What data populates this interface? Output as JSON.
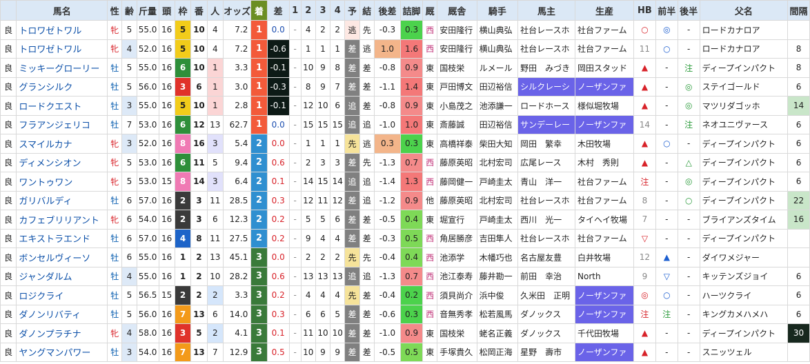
{
  "headers": [
    "馬名",
    "性",
    "齢",
    "斤量",
    "頭",
    "枠",
    "番",
    "人",
    "オッズ",
    "着",
    "差",
    "1",
    "2",
    "3",
    "4",
    "予",
    "結",
    "後差",
    "詰脚",
    "厩",
    "厩舎",
    "騎手",
    "馬主",
    "生産",
    "HB",
    "前半",
    "後半",
    "父名",
    "間隔"
  ],
  "colors": {
    "header_bg": "#dbe8f6",
    "finish_1": "#f35a3a",
    "finish_2": "#2f8fd0",
    "finish_3": "#3a7a3a",
    "gate_1": "#ffffff",
    "gate_2": "#3a3a3a",
    "gate_3": "#e0322a",
    "gate_4": "#1e64c8",
    "gate_5": "#f2cc1a",
    "gate_6": "#2e8f3a",
    "gate_7": "#f39a1a",
    "gate_8": "#f07ab4",
    "owner_highlight": "#6a63e8",
    "interval_bg": "#c9e6c9",
    "interval_dark": "#17281e"
  },
  "rows": [
    {
      "track": "良",
      "name": "トロワゼトワル",
      "sex": "牝",
      "age": "5",
      "weight": "55.0",
      "heads": "16",
      "gate": 5,
      "num": "10",
      "pop": "4",
      "odds": "7.2",
      "finish": "1",
      "margin": "0.0",
      "c1": "-",
      "c2": "4",
      "c3": "2",
      "c4": "2",
      "pred": "逃",
      "result": "先",
      "ato": "-0.3",
      "agari": "0.3",
      "east": "西",
      "trainer": "安田隆行",
      "jockey": "横山典弘",
      "owner": "社台レースホ",
      "breeder": "社台ファーム",
      "hb": "○",
      "zen": "◎",
      "kou": "-",
      "sire": "ロードカナロア",
      "interval": ""
    },
    {
      "track": "良",
      "name": "トロワゼトワル",
      "sex": "牝",
      "age": "4",
      "weight": "52.0",
      "heads": "16",
      "gate": 5,
      "num": "10",
      "pop": "4",
      "odds": "7.2",
      "finish": "1",
      "margin": "-0.6",
      "c1": "-",
      "c2": "1",
      "c3": "1",
      "c4": "1",
      "pred": "差",
      "result": "逃",
      "ato": "1.0",
      "agari": "1.6",
      "east": "西",
      "trainer": "安田隆行",
      "jockey": "横山典弘",
      "owner": "社台レースホ",
      "breeder": "社台ファーム",
      "hb": "11",
      "zen": "○",
      "kou": "-",
      "sire": "ロードカナロア",
      "interval": "8"
    },
    {
      "track": "良",
      "name": "ミッキーグローリー",
      "sex": "牡",
      "age": "5",
      "weight": "55.0",
      "heads": "16",
      "gate": 6,
      "num": "10",
      "pop": "1",
      "odds": "3.3",
      "finish": "1",
      "margin": "-0.1",
      "c1": "-",
      "c2": "10",
      "c3": "9",
      "c4": "8",
      "pred": "差",
      "result": "差",
      "ato": "-0.8",
      "agari": "0.9",
      "east": "東",
      "trainer": "国枝栄",
      "jockey": "ルメール",
      "owner": "野田　みづき",
      "breeder": "岡田スタッド",
      "hb": "▲",
      "zen": "-",
      "kou": "注",
      "sire": "ディープインパクト",
      "interval": "8"
    },
    {
      "track": "良",
      "name": "グランシルク",
      "sex": "牡",
      "age": "5",
      "weight": "56.0",
      "heads": "16",
      "gate": 3,
      "num": "6",
      "pop": "1",
      "odds": "3.0",
      "finish": "1",
      "margin": "-0.3",
      "c1": "-",
      "c2": "8",
      "c3": "9",
      "c4": "7",
      "pred": "差",
      "result": "差",
      "ato": "-1.1",
      "agari": "1.4",
      "east": "東",
      "trainer": "戸田博文",
      "jockey": "田辺裕信",
      "owner": "シルクレーシ",
      "breeder": "ノーザンファ",
      "hb": "▲",
      "zen": "-",
      "kou": "◎",
      "sire": "ステイゴールド",
      "interval": "6"
    },
    {
      "track": "良",
      "name": "ロードクエスト",
      "sex": "牡",
      "age": "3",
      "weight": "55.0",
      "heads": "16",
      "gate": 5,
      "num": "10",
      "pop": "1",
      "odds": "2.8",
      "finish": "1",
      "margin": "-0.1",
      "c1": "-",
      "c2": "12",
      "c3": "10",
      "c4": "6",
      "pred": "追",
      "result": "差",
      "ato": "-0.8",
      "agari": "0.9",
      "east": "東",
      "trainer": "小島茂之",
      "jockey": "池添謙一",
      "owner": "ロードホース",
      "breeder": "様似堀牧場",
      "hb": "▲",
      "zen": "-",
      "kou": "◎",
      "sire": "マツリダゴッホ",
      "interval": "14"
    },
    {
      "track": "良",
      "name": "フラアンジェリコ",
      "sex": "牡",
      "age": "7",
      "weight": "53.0",
      "heads": "16",
      "gate": 6,
      "num": "12",
      "pop": "13",
      "odds": "62.7",
      "finish": "1",
      "margin": "0.0",
      "c1": "-",
      "c2": "15",
      "c3": "15",
      "c4": "15",
      "pred": "追",
      "result": "追",
      "ato": "-1.0",
      "agari": "1.0",
      "east": "東",
      "trainer": "斎藤誠",
      "jockey": "田辺裕信",
      "owner": "サンデーレー",
      "breeder": "ノーザンファ",
      "hb": "14",
      "zen": "-",
      "kou": "注",
      "sire": "ネオユニヴァース",
      "interval": "6"
    },
    {
      "track": "良",
      "name": "スマイルカナ",
      "sex": "牝",
      "age": "3",
      "weight": "52.0",
      "heads": "16",
      "gate": 8,
      "num": "16",
      "pop": "3",
      "odds": "5.4",
      "finish": "2",
      "margin": "0.0",
      "c1": "-",
      "c2": "1",
      "c3": "1",
      "c4": "1",
      "pred": "先",
      "result": "逃",
      "ato": "0.3",
      "agari": "0.3",
      "east": "東",
      "trainer": "高橋祥泰",
      "jockey": "柴田大知",
      "owner": "岡田　繁幸",
      "breeder": "木田牧場",
      "hb": "▲",
      "zen": "○",
      "kou": "-",
      "sire": "ディープインパクト",
      "interval": "6"
    },
    {
      "track": "良",
      "name": "ディメンシオン",
      "sex": "牝",
      "age": "5",
      "weight": "53.0",
      "heads": "16",
      "gate": 6,
      "num": "11",
      "pop": "5",
      "odds": "9.4",
      "finish": "2",
      "margin": "0.6",
      "c1": "-",
      "c2": "2",
      "c3": "3",
      "c4": "3",
      "pred": "差",
      "result": "先",
      "ato": "-1.3",
      "agari": "0.7",
      "east": "西",
      "trainer": "藤原英昭",
      "jockey": "北村宏司",
      "owner": "広尾レース",
      "breeder": "木村　秀則",
      "hb": "▲",
      "zen": "-",
      "kou": "△",
      "sire": "ディープインパクト",
      "interval": "6"
    },
    {
      "track": "良",
      "name": "ワントゥワン",
      "sex": "牝",
      "age": "5",
      "weight": "53.0",
      "heads": "15",
      "gate": 8,
      "num": "14",
      "pop": "3",
      "odds": "6.4",
      "finish": "2",
      "margin": "0.1",
      "c1": "-",
      "c2": "14",
      "c3": "15",
      "c4": "14",
      "pred": "追",
      "result": "追",
      "ato": "-1.4",
      "agari": "1.3",
      "east": "西",
      "trainer": "藤岡健一",
      "jockey": "戸崎圭太",
      "owner": "青山　洋一",
      "breeder": "社台ファーム",
      "hb": "注",
      "zen": "-",
      "kou": "◎",
      "sire": "ディープインパクト",
      "interval": "6"
    },
    {
      "track": "良",
      "name": "ガリバルディ",
      "sex": "牡",
      "age": "6",
      "weight": "57.0",
      "heads": "16",
      "gate": 2,
      "num": "3",
      "pop": "11",
      "odds": "28.5",
      "finish": "2",
      "margin": "0.3",
      "c1": "-",
      "c2": "12",
      "c3": "11",
      "c4": "12",
      "pred": "差",
      "result": "追",
      "ato": "-1.2",
      "agari": "0.9",
      "east": "他",
      "trainer": "藤原英昭",
      "jockey": "北村宏司",
      "owner": "社台レースホ",
      "breeder": "社台ファーム",
      "hb": "8",
      "zen": "-",
      "kou": "○",
      "sire": "ディープインパクト",
      "interval": "22"
    },
    {
      "track": "良",
      "name": "カフェブリリアント",
      "sex": "牝",
      "age": "6",
      "weight": "54.0",
      "heads": "16",
      "gate": 2,
      "num": "3",
      "pop": "6",
      "odds": "12.3",
      "finish": "2",
      "margin": "0.2",
      "c1": "-",
      "c2": "5",
      "c3": "5",
      "c4": "6",
      "pred": "差",
      "result": "差",
      "ato": "-0.5",
      "agari": "0.4",
      "east": "東",
      "trainer": "堀宣行",
      "jockey": "戸崎圭太",
      "owner": "西川　光一",
      "breeder": "タイヘイ牧場",
      "hb": "7",
      "zen": "-",
      "kou": "-",
      "sire": "ブライアンズタイム",
      "interval": "16"
    },
    {
      "track": "良",
      "name": "エキストラエンド",
      "sex": "牡",
      "age": "6",
      "weight": "57.0",
      "heads": "16",
      "gate": 4,
      "num": "8",
      "pop": "11",
      "odds": "27.5",
      "finish": "2",
      "margin": "0.2",
      "c1": "-",
      "c2": "9",
      "c3": "4",
      "c4": "4",
      "pred": "差",
      "result": "差",
      "ato": "-0.3",
      "agari": "0.5",
      "east": "西",
      "trainer": "角居勝彦",
      "jockey": "吉田隼人",
      "owner": "社台レースホ",
      "breeder": "社台ファーム",
      "hb": "▽",
      "zen": "-",
      "kou": "-",
      "sire": "ディープインパクト",
      "interval": ""
    },
    {
      "track": "良",
      "name": "ボンセルヴィーソ",
      "sex": "牡",
      "age": "6",
      "weight": "55.0",
      "heads": "16",
      "gate": 1,
      "num": "2",
      "pop": "13",
      "odds": "45.1",
      "finish": "3",
      "margin": "0.0",
      "c1": "-",
      "c2": "2",
      "c3": "2",
      "c4": "2",
      "pred": "先",
      "result": "先",
      "ato": "-0.4",
      "agari": "0.4",
      "east": "西",
      "trainer": "池添学",
      "jockey": "木幡巧也",
      "owner": "名古屋友豊",
      "breeder": "白井牧場",
      "hb": "12",
      "zen": "▲",
      "kou": "-",
      "sire": "ダイワメジャー",
      "interval": ""
    },
    {
      "track": "良",
      "name": "ジャンダルム",
      "sex": "牡",
      "age": "4",
      "weight": "55.0",
      "heads": "16",
      "gate": 1,
      "num": "2",
      "pop": "10",
      "odds": "28.2",
      "finish": "3",
      "margin": "0.6",
      "c1": "-",
      "c2": "13",
      "c3": "13",
      "c4": "13",
      "pred": "追",
      "result": "追",
      "ato": "-1.3",
      "agari": "0.7",
      "east": "西",
      "trainer": "池江泰寿",
      "jockey": "藤井勘一",
      "owner": "前田　幸治",
      "breeder": "North",
      "hb": "9",
      "zen": "▽",
      "kou": "-",
      "sire": "キッテンズジョイ",
      "interval": "6"
    },
    {
      "track": "良",
      "name": "ロジクライ",
      "sex": "牡",
      "age": "5",
      "weight": "56.5",
      "heads": "15",
      "gate": 2,
      "num": "2",
      "pop": "2",
      "odds": "3.3",
      "finish": "3",
      "margin": "0.2",
      "c1": "-",
      "c2": "4",
      "c3": "4",
      "c4": "4",
      "pred": "先",
      "result": "差",
      "ato": "-0.4",
      "agari": "0.2",
      "east": "西",
      "trainer": "須貝尚介",
      "jockey": "浜中俊",
      "owner": "久米田　正明",
      "breeder": "ノーザンファ",
      "hb": "◎",
      "zen": "○",
      "kou": "-",
      "sire": "ハーツクライ",
      "interval": "6"
    },
    {
      "track": "良",
      "name": "ダノンリバティ",
      "sex": "牡",
      "age": "5",
      "weight": "56.0",
      "heads": "16",
      "gate": 7,
      "num": "13",
      "pop": "6",
      "odds": "14.0",
      "finish": "3",
      "margin": "0.3",
      "c1": "-",
      "c2": "6",
      "c3": "6",
      "c4": "5",
      "pred": "差",
      "result": "差",
      "ato": "-0.6",
      "agari": "0.3",
      "east": "西",
      "trainer": "音無秀孝",
      "jockey": "松若風馬",
      "owner": "ダノックス",
      "breeder": "ノーザンファ",
      "hb": "注",
      "zen": "注",
      "kou": "-",
      "sire": "キングカメハメハ",
      "interval": "6"
    },
    {
      "track": "良",
      "name": "ダノンプラチナ",
      "sex": "牝",
      "age": "4",
      "weight": "58.0",
      "heads": "16",
      "gate": 3,
      "num": "5",
      "pop": "2",
      "odds": "4.1",
      "finish": "3",
      "margin": "0.1",
      "c1": "-",
      "c2": "11",
      "c3": "10",
      "c4": "10",
      "pred": "差",
      "result": "差",
      "ato": "-1.0",
      "agari": "0.9",
      "east": "東",
      "trainer": "国枝栄",
      "jockey": "蛯名正義",
      "owner": "ダノックス",
      "breeder": "千代田牧場",
      "hb": "▲",
      "zen": "-",
      "kou": "-",
      "sire": "ディープインパクト",
      "interval": "30"
    },
    {
      "track": "良",
      "name": "ヤングマンパワー",
      "sex": "牡",
      "age": "3",
      "weight": "54.0",
      "heads": "16",
      "gate": 7,
      "num": "13",
      "pop": "7",
      "odds": "12.9",
      "finish": "3",
      "margin": "0.5",
      "c1": "-",
      "c2": "10",
      "c3": "9",
      "c4": "9",
      "pred": "差",
      "result": "差",
      "ato": "-0.5",
      "agari": "0.5",
      "east": "東",
      "trainer": "手塚貴久",
      "jockey": "松岡正海",
      "owner": "星野　壽市",
      "breeder": "ノーザンファ",
      "hb": "▲",
      "zen": "-",
      "kou": "-",
      "sire": "スニッツェル",
      "interval": ""
    }
  ]
}
